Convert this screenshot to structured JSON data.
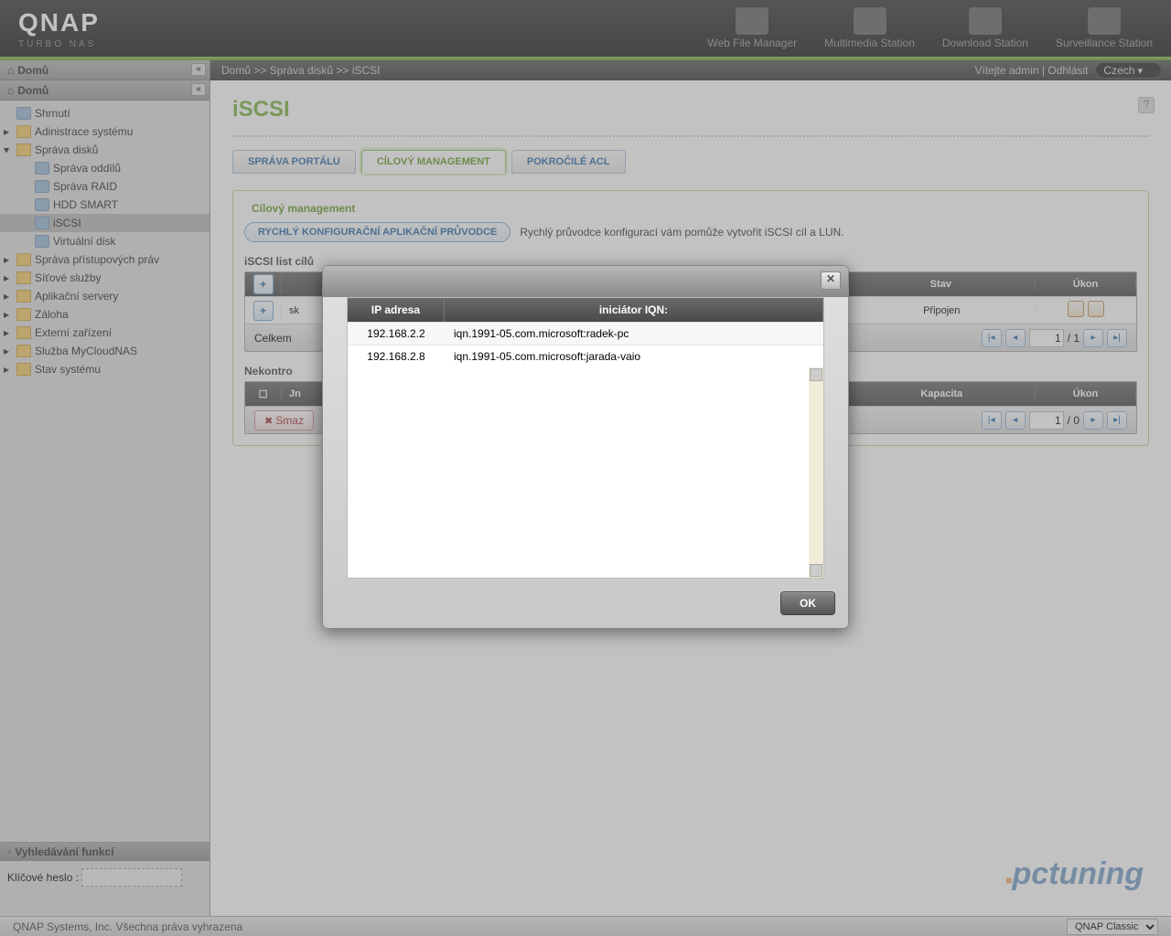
{
  "header": {
    "brand": "QNAP",
    "brand_sub": "TURBO NAS",
    "apps": [
      "Web File Manager",
      "Multimedia Station",
      "Download Station",
      "Surveillance Station"
    ]
  },
  "crumb": {
    "left_home": "Domů",
    "trail": "Domů >> Správa disků >> iSCSI",
    "welcome": "Vítejte admin",
    "logout": "Odhlásit",
    "lang": "Czech"
  },
  "sidebar": {
    "title": "Domů",
    "items": [
      {
        "label": "Shrnutí",
        "depth": 0,
        "kind": "leaf"
      },
      {
        "label": "Adinistrace systému",
        "depth": 0,
        "kind": "fold"
      },
      {
        "label": "Správa disků",
        "depth": 0,
        "kind": "fold",
        "expanded": true
      },
      {
        "label": "Správa oddílů",
        "depth": 1,
        "kind": "leaf"
      },
      {
        "label": "Správa RAID",
        "depth": 1,
        "kind": "leaf"
      },
      {
        "label": "HDD SMART",
        "depth": 1,
        "kind": "leaf"
      },
      {
        "label": "iSCSI",
        "depth": 1,
        "kind": "leaf",
        "selected": true
      },
      {
        "label": "Virtuální disk",
        "depth": 1,
        "kind": "leaf"
      },
      {
        "label": "Správa přístupových práv",
        "depth": 0,
        "kind": "fold"
      },
      {
        "label": "Síťové služby",
        "depth": 0,
        "kind": "fold"
      },
      {
        "label": "Aplikační servery",
        "depth": 0,
        "kind": "fold"
      },
      {
        "label": "Záloha",
        "depth": 0,
        "kind": "fold"
      },
      {
        "label": "Externí zařízení",
        "depth": 0,
        "kind": "fold"
      },
      {
        "label": "Služba MyCloudNAS",
        "depth": 0,
        "kind": "fold"
      },
      {
        "label": "Stav systému",
        "depth": 0,
        "kind": "fold"
      }
    ],
    "search_title": "Vyhledávání funkcí",
    "search_label": "Klíčové heslo :"
  },
  "page": {
    "title": "iSCSI",
    "tabs": [
      "SPRÁVA PORTÁLU",
      "CÍLOVÝ MANAGEMENT",
      "POKROČILÉ ACL"
    ],
    "active_tab": 1,
    "section_title": "Cílový management",
    "wizard_btn": "RYCHLÝ KONFIGURAČNÍ APLIKAČNÍ PRŮVODCE",
    "wizard_text": "Rychlý průvodce konfigurací vám pomůže vytvořit iSCSI cíl a LUN.",
    "grid1_title": "iSCSI list cílů",
    "grid1_cols": [
      "",
      "",
      "Stav",
      "Úkon"
    ],
    "grid1_row": {
      "name_prefix": "sk",
      "status": "Připojen"
    },
    "grid1_total_label": "Celkem",
    "page_of_1": "/ 1",
    "grid2_title": "Nekontro",
    "grid2_cols": [
      "",
      "Jn",
      "Kapacita",
      "Úkon"
    ],
    "delete_btn": "Smaz",
    "page_of_0": "/ 0",
    "page_val": "1"
  },
  "modal": {
    "col_ip": "IP adresa",
    "col_iqn": "iniciátor IQN:",
    "rows": [
      {
        "ip": "192.168.2.2",
        "iqn": "iqn.1991-05.com.microsoft:radek-pc"
      },
      {
        "ip": "192.168.2.8",
        "iqn": "iqn.1991-05.com.microsoft:jarada-vaio"
      }
    ],
    "ok": "OK"
  },
  "footer": {
    "copyright": "QNAP Systems, Inc. Všechna práva vyhrazena",
    "theme": "QNAP Classic"
  }
}
